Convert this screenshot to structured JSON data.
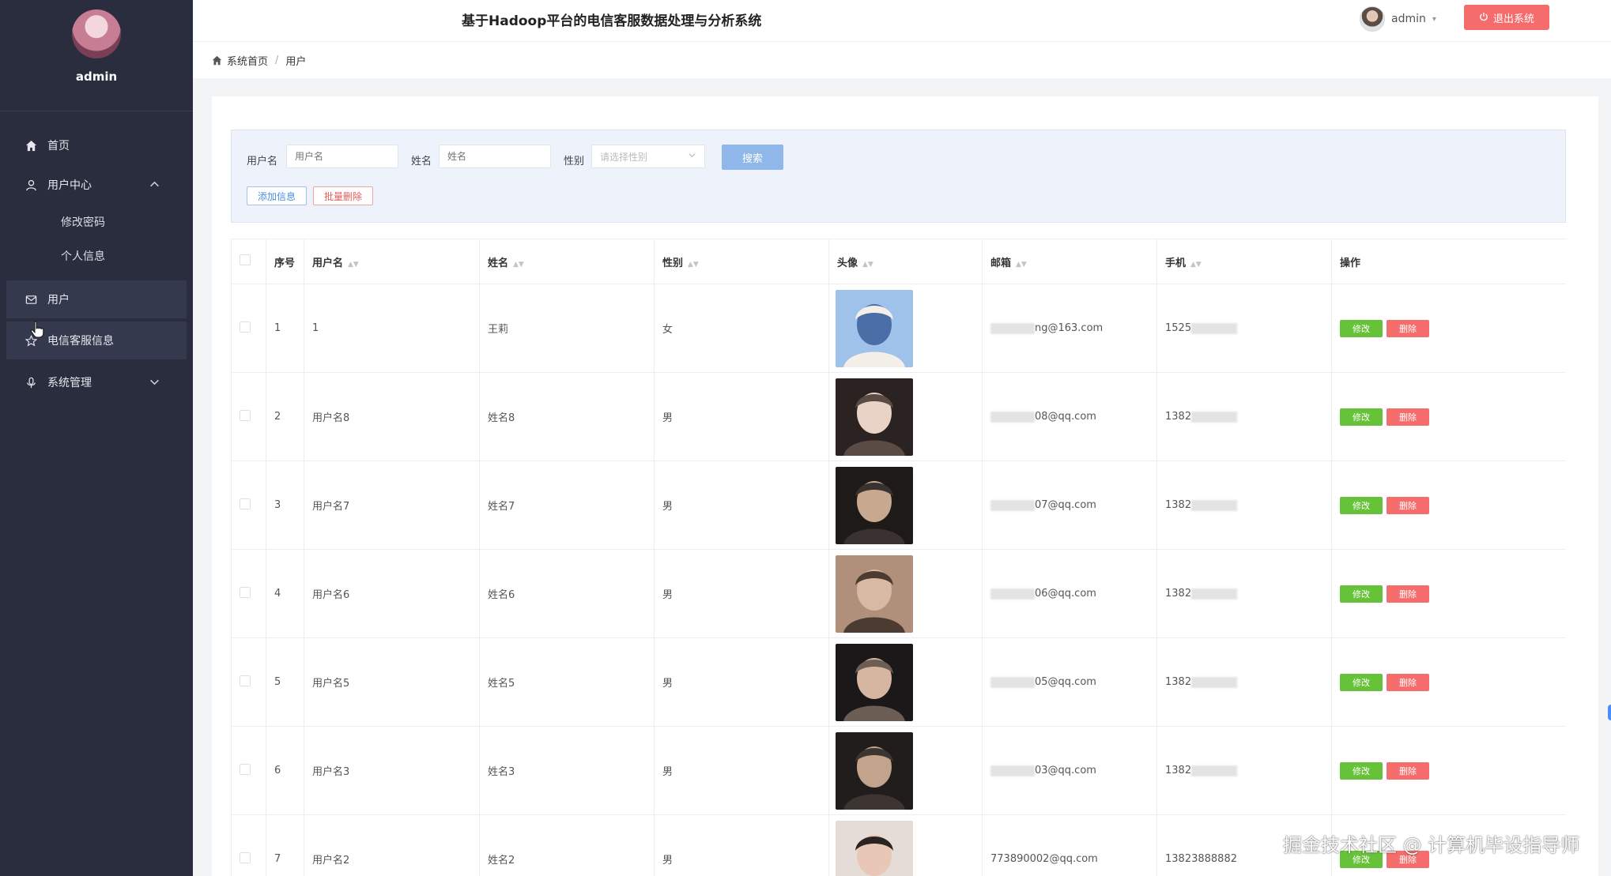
{
  "sidebar": {
    "username": "admin",
    "menu": [
      {
        "label": "首页",
        "icon": "home-icon"
      },
      {
        "label": "用户中心",
        "icon": "user-icon",
        "expanded": true,
        "children": [
          {
            "label": "修改密码"
          },
          {
            "label": "个人信息"
          }
        ]
      },
      {
        "label": "用户",
        "icon": "mail-icon",
        "active": true
      },
      {
        "label": "电信客服信息",
        "icon": "star-icon"
      },
      {
        "label": "系统管理",
        "icon": "microphone-icon",
        "expanded": false
      }
    ]
  },
  "header": {
    "title": "基于Hadoop平台的电信客服数据处理与分析系统",
    "user": "admin",
    "logout_label": "退出系统"
  },
  "breadcrumb": {
    "home": "系统首页",
    "current": "用户"
  },
  "search": {
    "username_label": "用户名",
    "username_placeholder": "用户名",
    "name_label": "姓名",
    "name_placeholder": "姓名",
    "gender_label": "性别",
    "gender_placeholder": "请选择性别",
    "search_label": "搜索",
    "add_label": "添加信息",
    "batch_delete_label": "批量删除"
  },
  "table": {
    "headers": {
      "index": "序号",
      "username": "用户名",
      "name": "姓名",
      "gender": "性别",
      "avatar": "头像",
      "email": "邮箱",
      "phone": "手机",
      "actions": "操作"
    },
    "edit_label": "修改",
    "delete_label": "删除",
    "rows": [
      {
        "index": "1",
        "username": "1",
        "name": "王莉",
        "gender": "女",
        "email": "ng@163.com",
        "phone": "1525",
        "avatar_style": "anime"
      },
      {
        "index": "2",
        "username": "用户名8",
        "name": "姓名8",
        "gender": "男",
        "email": "08@qq.com",
        "phone": "1382",
        "avatar_style": "photo"
      },
      {
        "index": "3",
        "username": "用户名7",
        "name": "姓名7",
        "gender": "男",
        "email": "07@qq.com",
        "phone": "1382",
        "avatar_style": "photo"
      },
      {
        "index": "4",
        "username": "用户名6",
        "name": "姓名6",
        "gender": "男",
        "email": "06@qq.com",
        "phone": "1382",
        "avatar_style": "photo"
      },
      {
        "index": "5",
        "username": "用户名5",
        "name": "姓名5",
        "gender": "男",
        "email": "05@qq.com",
        "phone": "1382",
        "avatar_style": "photo"
      },
      {
        "index": "6",
        "username": "用户名3",
        "name": "姓名3",
        "gender": "男",
        "email": "03@qq.com",
        "phone": "1382",
        "avatar_style": "photo"
      },
      {
        "index": "7",
        "username": "用户名2",
        "name": "姓名2",
        "gender": "男",
        "email": "773890002@qq.com",
        "phone": "13823888882",
        "avatar_style": "photo"
      }
    ]
  },
  "watermark": "掘金技术社区 @ 计算机毕设指导师",
  "colors": {
    "sidebar_bg": "#2a2d3d",
    "primary": "#4a8ee2",
    "danger": "#f56c6c",
    "success": "#67c23a"
  }
}
